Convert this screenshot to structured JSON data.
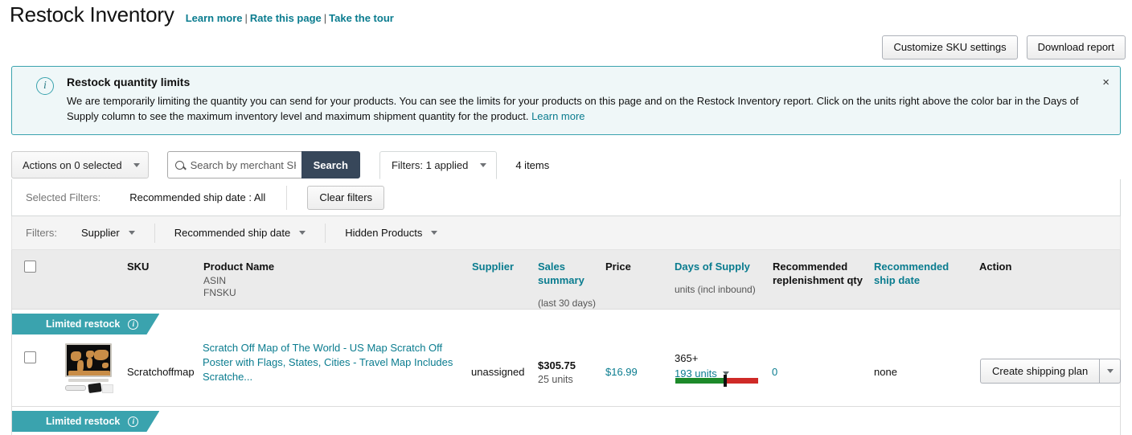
{
  "header": {
    "title": "Restock Inventory",
    "links": [
      {
        "label": "Learn more"
      },
      {
        "label": "Rate this page"
      },
      {
        "label": "Take the tour"
      }
    ],
    "separator": "|",
    "buttons": {
      "customize": "Customize SKU settings",
      "download": "Download report"
    }
  },
  "alert": {
    "icon": "info-icon",
    "title": "Restock quantity limits",
    "body": "We are temporarily limiting the quantity you can send for your products. You can see the limits for your products on this page and on the Restock Inventory report. Click on the units right above the color bar in the Days of Supply column to see the maximum inventory level and maximum shipment quantity for the product.",
    "link": "Learn more",
    "close": "×",
    "accent": "#3aa3ae",
    "background": "#eff7f8"
  },
  "toolbar": {
    "actions_label": "Actions on 0 selected",
    "search_placeholder": "Search by merchant SKU",
    "search_value": "",
    "search_button": "Search",
    "filters_tab": "Filters: 1 applied",
    "item_count": "4 items"
  },
  "selected_filters": {
    "label": "Selected Filters:",
    "value": "Recommended ship date : All",
    "clear_button": "Clear filters"
  },
  "filters": {
    "label": "Filters:",
    "items": [
      {
        "label": "Supplier"
      },
      {
        "label": "Recommended ship date"
      },
      {
        "label": "Hidden Products"
      }
    ]
  },
  "table": {
    "columns": {
      "sku": "SKU",
      "product_name": "Product Name",
      "product_sub1": "ASIN",
      "product_sub2": "FNSKU",
      "supplier": "Supplier",
      "sales_summary_line1": "Sales",
      "sales_summary_line2": "summary",
      "sales_summary_sub": "(last 30 days)",
      "price": "Price",
      "days_of_supply": "Days of Supply",
      "days_of_supply_sub": "units (incl inbound)",
      "replenishment_line1": "Recommended",
      "replenishment_line2": "replenishment qty",
      "ship_date_line1": "Recommended",
      "ship_date_line2": "ship date",
      "action": "Action"
    },
    "rows": [
      {
        "badge": "Limited restock",
        "badge_icon": "info-icon",
        "sku": "Scratchoffmap",
        "product_name": "Scratch Off Map of The World - US Map Scratch Off Poster with Flags, States, Cities - Travel Map Includes Scratche...",
        "supplier": "unassigned",
        "sales_amount": "$305.75",
        "sales_units": "25 units",
        "price": "$16.99",
        "days_of_supply": "365+",
        "units_link": "193 units",
        "bar_green_percent": 60,
        "bar_marker_percent": 60,
        "bar_green_color": "#1d8a2a",
        "bar_red_color": "#cf2a27",
        "replenishment_qty": "0",
        "ship_date": "none",
        "action_button": "Create shipping plan"
      },
      {
        "badge": "Limited restock",
        "badge_icon": "info-icon"
      }
    ]
  }
}
